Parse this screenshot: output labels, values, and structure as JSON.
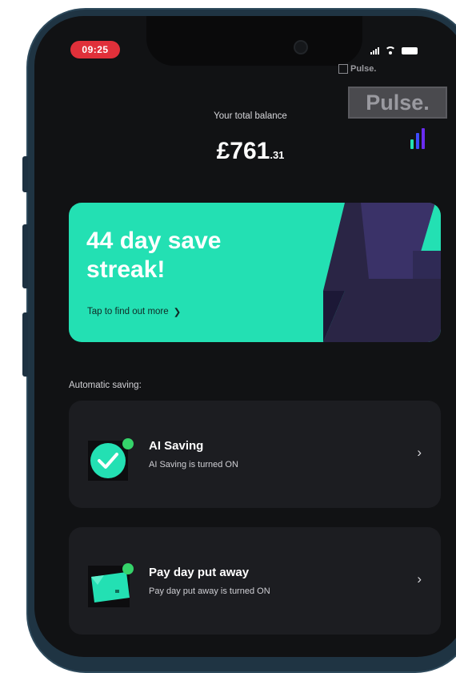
{
  "status_bar": {
    "time": "09:25"
  },
  "brand": {
    "small_label": "Pulse.",
    "logo_text": "Pulse."
  },
  "balance": {
    "label": "Your total balance",
    "pounds": "£761",
    "pence": ".31"
  },
  "streak_card": {
    "title": "44 day save streak!",
    "link": "Tap to find out more",
    "link_chevron": "❯",
    "background": "#23e0b3"
  },
  "section": {
    "label": "Automatic saving:"
  },
  "rows": [
    {
      "icon": "shield-check-icon",
      "title": "AI Saving",
      "subtitle": "AI Saving is turned ON",
      "chevron": "›",
      "status_color": "#35d36a"
    },
    {
      "icon": "cash-note-icon",
      "title": "Pay day put away",
      "subtitle": "Pay day put away is turned ON",
      "chevron": "›",
      "status_color": "#35d36a"
    }
  ],
  "colors": {
    "accent": "#23e0b3",
    "background": "#111214",
    "card": "#1c1d21",
    "status_on": "#35d36a",
    "time_pill": "#e0303a"
  }
}
